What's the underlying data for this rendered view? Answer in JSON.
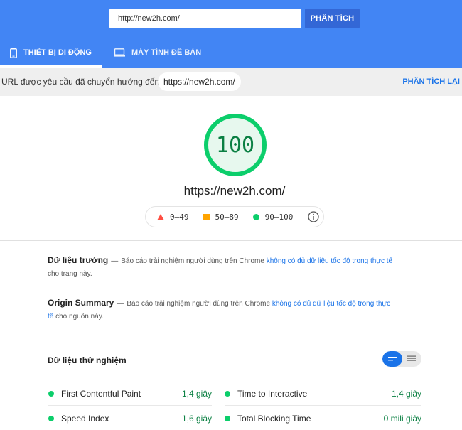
{
  "header": {
    "url_value": "http://new2h.com/",
    "analyze_label": "PHÂN TÍCH",
    "tabs": [
      {
        "label": "THIẾT BỊ DI ĐỘNG",
        "icon": "mobile-icon",
        "active": true
      },
      {
        "label": "MÁY TÍNH ĐỂ BÀN",
        "icon": "desktop-icon",
        "active": false
      }
    ],
    "bg_color": "#4285f4"
  },
  "redirect": {
    "text": "URL được yêu cầu đã chuyển hướng đến:",
    "url": "https://new2h.com/",
    "reanalyze_label": "PHÂN TÍCH LẠI"
  },
  "score": {
    "value": "100",
    "fraction": 1.0,
    "color": "#0cce6b",
    "url": "https://new2h.com/"
  },
  "legend": {
    "items": [
      {
        "range": "0–49",
        "shape": "triangle",
        "color": "#ff4e42"
      },
      {
        "range": "50–89",
        "shape": "square",
        "color": "#ffa400"
      },
      {
        "range": "90–100",
        "shape": "circle",
        "color": "#0cce6b"
      }
    ],
    "info_icon": "info-icon"
  },
  "field_data": {
    "title": "Dữ liệu trường",
    "dash": "—",
    "text_before": "Báo cáo trải nghiệm người dùng trên Chrome",
    "link": "không có đủ dữ liệu tốc độ trong thực tế",
    "text_after": "cho trang này."
  },
  "origin_summary": {
    "title": "Origin Summary",
    "dash": "—",
    "text_before": "Báo cáo trải nghiệm người dùng trên Chrome",
    "link": "không có đủ dữ liệu tốc độ trong thực tế",
    "text_after": "cho nguồn này."
  },
  "lab_data": {
    "title": "Dữ liệu thử nghiệm",
    "toggle": [
      "compact-view-icon",
      "expanded-view-icon"
    ],
    "metrics": [
      {
        "name": "First Contentful Paint",
        "value": "1,4 giây"
      },
      {
        "name": "Time to Interactive",
        "value": "1,4 giây"
      },
      {
        "name": "Speed Index",
        "value": "1,6 giây"
      },
      {
        "name": "Total Blocking Time",
        "value": "0 mili giây"
      }
    ]
  }
}
